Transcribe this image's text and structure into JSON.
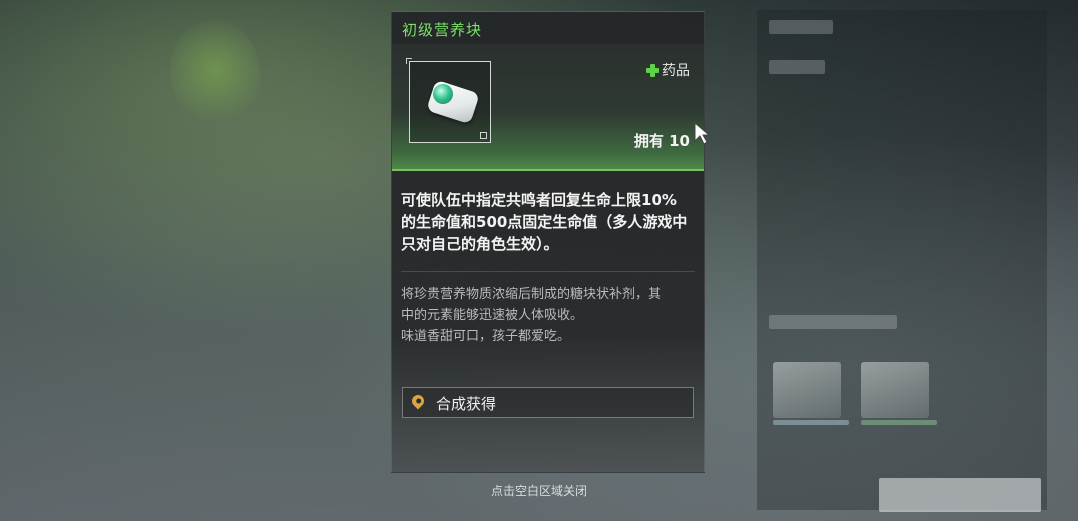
{
  "item": {
    "name": "初级营养块",
    "category": "药品",
    "owned": "拥有 10",
    "effect": "可使队伍中指定共鸣者回复生命上限10%\n的生命值和500点固定生命值（多人游戏中\n只对自己的角色生效）。",
    "lore": "将珍贵营养物质浓缩后制成的糖块状补剂，其\n中的元素能够迅速被人体吸收。\n味道香甜可口，孩子都爱吃。",
    "source": "合成获得"
  },
  "hint": "点击空白区域关闭",
  "colors": {
    "title_green": "#7ce06a",
    "accent_green": "#79c25f",
    "pin": "#d9a441"
  },
  "icons": {
    "category": "plus-icon",
    "source": "location-pin-icon",
    "item": "nutrient-block-icon"
  }
}
